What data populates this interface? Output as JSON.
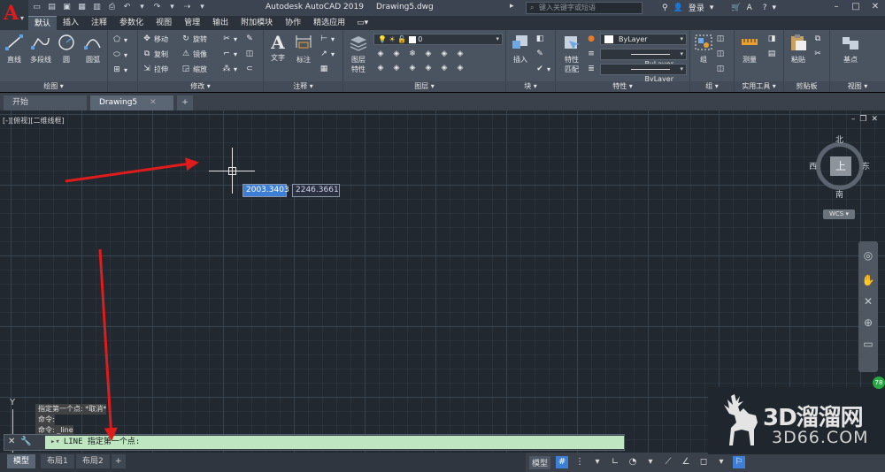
{
  "app": {
    "title": "Autodesk AutoCAD 2019",
    "document": "Drawing5.dwg",
    "logo_letter": "A"
  },
  "search": {
    "placeholder": "键入关键字或短语"
  },
  "account": {
    "login_label": "登录"
  },
  "quick_access": [
    "new-icon",
    "open-icon",
    "save-icon",
    "saveas-icon",
    "print-icon",
    "undo-icon",
    "redo-icon"
  ],
  "ribbon_tabs": [
    {
      "label": "默认",
      "active": true
    },
    {
      "label": "插入"
    },
    {
      "label": "注释"
    },
    {
      "label": "参数化"
    },
    {
      "label": "视图"
    },
    {
      "label": "管理"
    },
    {
      "label": "输出"
    },
    {
      "label": "附加模块"
    },
    {
      "label": "协作"
    },
    {
      "label": "精选应用"
    }
  ],
  "panels": {
    "draw": {
      "title": "绘图",
      "line": "直线",
      "polyline": "多段线",
      "circle": "圆",
      "arc": "圆弧"
    },
    "modify": {
      "title": "修改",
      "move": "移动",
      "rotate": "旋转",
      "copy": "复制",
      "mirror": "镜像",
      "stretch": "拉伸",
      "scale": "缩放"
    },
    "annotation": {
      "title": "注释",
      "text": "文字",
      "dimension": "标注"
    },
    "layers": {
      "title": "图层",
      "properties_line1": "图层",
      "properties_line2": "特性",
      "current_layer": "0"
    },
    "block": {
      "title": "块",
      "insert": "插入"
    },
    "properties": {
      "title": "特性",
      "match_line1": "特性",
      "match_line2": "匹配",
      "color": "ByLayer",
      "linetype": "ByLayer",
      "lineweight": "ByLayer"
    },
    "groups": {
      "title": "组",
      "group": "组"
    },
    "utilities": {
      "title": "实用工具",
      "measure": "测量"
    },
    "clipboard": {
      "title": "剪贴板",
      "paste": "粘贴"
    },
    "view": {
      "title": "视图",
      "base": "基点"
    }
  },
  "doc_tabs": [
    {
      "label": "开始"
    },
    {
      "label": "Drawing5",
      "active": true
    }
  ],
  "viewport": {
    "label": "[-][俯视][二维线框]"
  },
  "dynamic_input": {
    "x": "2003.3403",
    "y": "2246.3661"
  },
  "viewcube": {
    "north": "北",
    "south": "南",
    "east": "东",
    "west": "西",
    "face": "上",
    "wcs": "WCS"
  },
  "ucs": {
    "y_label": "Y"
  },
  "command_history": [
    "指定第一个点: *取消*",
    "命令:",
    "命令: _line"
  ],
  "command_line": {
    "text": "LINE 指定第一个点:"
  },
  "layout_tabs": [
    {
      "label": "模型",
      "active": true
    },
    {
      "label": "布局1"
    },
    {
      "label": "布局2"
    }
  ],
  "status": {
    "model": "模型"
  },
  "watermark": {
    "title": "3D溜溜网",
    "url": "3D66.COM"
  },
  "badge": "78",
  "colors": {
    "canvas_bg": "#212830",
    "ribbon_bg": "#4a5461",
    "command_input_bg": "#bde6c1",
    "arrow": "#e01b1b",
    "dynamic_active": "#3d7fd6"
  }
}
